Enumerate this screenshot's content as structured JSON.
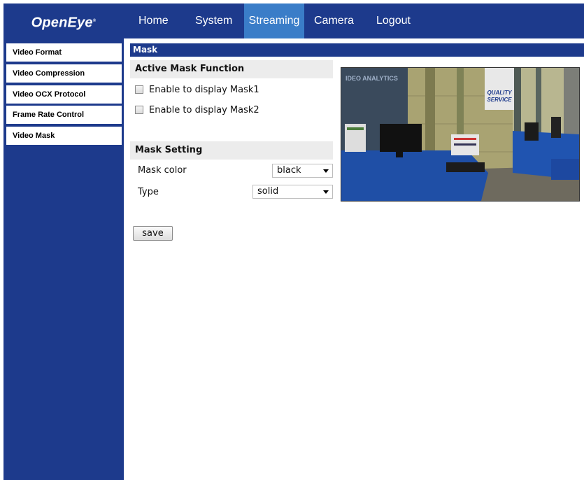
{
  "header": {
    "logo": "OpenEye",
    "logo_mark": "®",
    "nav": [
      {
        "label": "Home",
        "active": false
      },
      {
        "label": "System",
        "active": false
      },
      {
        "label": "Streaming",
        "active": true
      },
      {
        "label": "Camera",
        "active": false
      },
      {
        "label": "Logout",
        "active": false
      }
    ]
  },
  "sidebar": {
    "items": [
      {
        "label": "Video Format"
      },
      {
        "label": "Video Compression"
      },
      {
        "label": "Video OCX Protocol"
      },
      {
        "label": "Frame Rate Control"
      },
      {
        "label": "Video Mask"
      }
    ]
  },
  "main": {
    "title": "Mask",
    "active_mask": {
      "heading": "Active Mask Function",
      "mask1_label": "Enable to display Mask1",
      "mask1_checked": false,
      "mask2_label": "Enable to display Mask2",
      "mask2_checked": false
    },
    "mask_setting": {
      "heading": "Mask Setting",
      "color_label": "Mask color",
      "color_value": "black",
      "type_label": "Type",
      "type_value": "solid"
    },
    "save_label": "save"
  },
  "preview": {
    "sign_top": "IDEO ANALYTICS",
    "sign_banner_line1": "QUALITY",
    "sign_banner_line2": "SERVICE"
  },
  "colors": {
    "brand_navy": "#1d3a8c",
    "nav_active": "#3a7dc8",
    "section_bg": "#ececec"
  }
}
